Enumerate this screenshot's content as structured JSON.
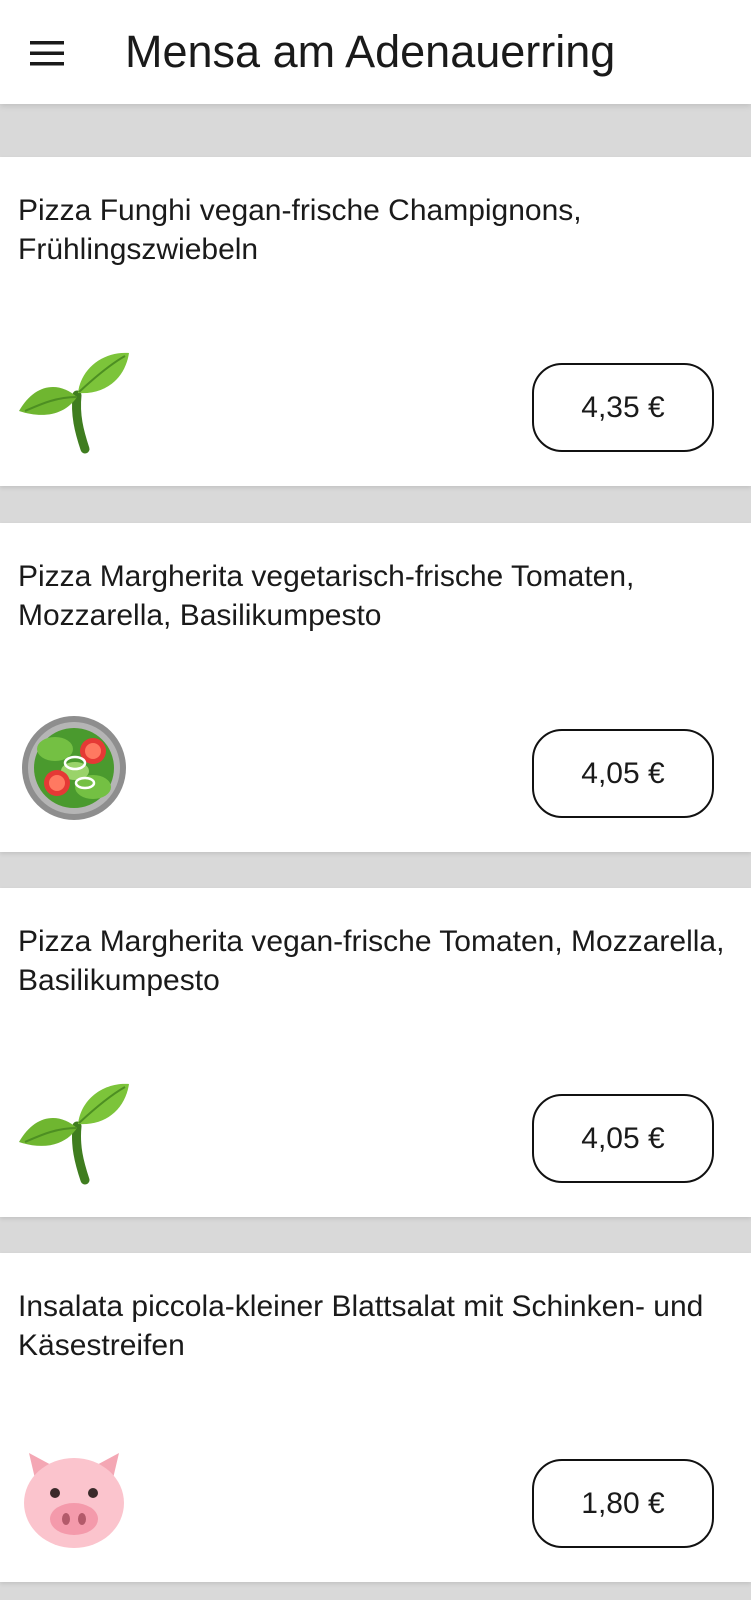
{
  "header": {
    "menu_icon": "hamburger-menu-icon",
    "title": "Mensa am Adenauerring"
  },
  "meals": [
    {
      "name": "Pizza Funghi vegan-frische Champignons, Frühlingszwiebeln",
      "price": "4,35 €",
      "icon": "seedling-icon"
    },
    {
      "name": "Pizza Margherita vegetarisch-frische Tomaten, Mozzarella, Basilikumpesto",
      "price": "4,05 €",
      "icon": "salad-icon"
    },
    {
      "name": "Pizza Margherita vegan-frische Tomaten, Mozzarella, Basilikumpesto",
      "price": "4,05 €",
      "icon": "seedling-icon"
    },
    {
      "name": "Insalata piccola-kleiner Blattsalat mit Schinken- und Käsestreifen",
      "price": "1,80 €",
      "icon": "pig-face-icon"
    }
  ],
  "colors": {
    "background": "#d9d9d9",
    "card": "#ffffff",
    "text": "#1a1a1a",
    "leaf_green": "#6fb630"
  }
}
